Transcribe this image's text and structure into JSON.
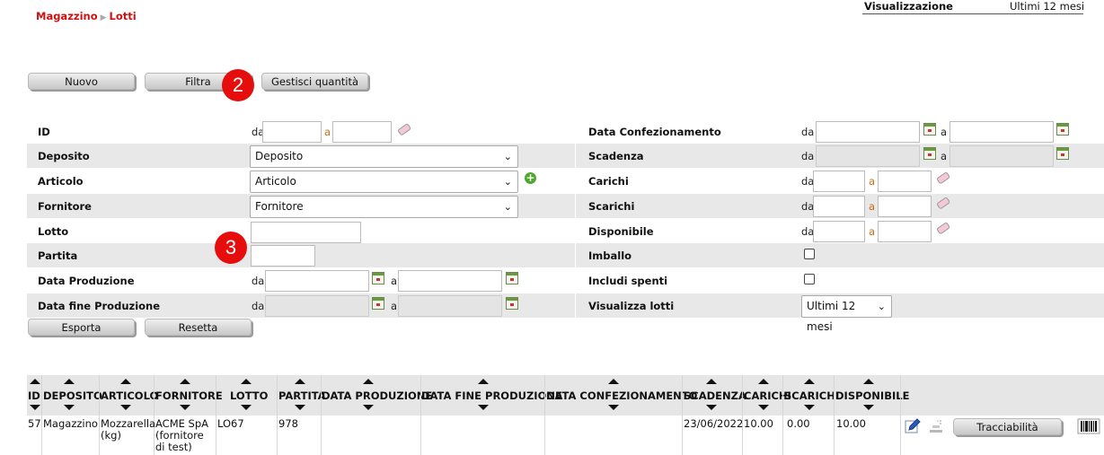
{
  "breadcrumb": {
    "first": "Magazzino",
    "second": "Lotti"
  },
  "view": {
    "label": "Visualizzazione",
    "value": "Ultimi 12 mesi"
  },
  "toolbar": {
    "new": "Nuovo",
    "filter": "Filtra",
    "manage_qty": "Gestisci quantità"
  },
  "badges": {
    "b2": "2",
    "b3": "3"
  },
  "filters": {
    "da": "da",
    "a": "a",
    "id": "ID",
    "deposito": "Deposito",
    "deposito_value": "Deposito",
    "articolo": "Articolo",
    "articolo_value": "Articolo",
    "fornitore": "Fornitore",
    "fornitore_value": "Fornitore",
    "lotto": "Lotto",
    "partita": "Partita",
    "data_produzione": "Data Produzione",
    "data_fine_produzione": "Data fine Produzione",
    "data_confezionamento": "Data Confezionamento",
    "scadenza": "Scadenza",
    "carichi": "Carichi",
    "scarichi": "Scarichi",
    "disponibile": "Disponibile",
    "imballo": "Imballo",
    "includi_spenti": "Includi spenti",
    "visualizza_lotti": "Visualizza lotti",
    "visualizza_lotti_value": "Ultimi 12 mesi"
  },
  "actions": {
    "export": "Esporta",
    "reset": "Resetta"
  },
  "table": {
    "headers": [
      "ID",
      "DEPOSITO",
      "ARTICOLO",
      "FORNITORE",
      "LOTTO",
      "PARTITA",
      "DATA PRODUZIONE",
      "DATA FINE PRODUZIONE",
      "DATA CONFEZIONAMENTO",
      "SCADENZA",
      "CARICHI",
      "SCARICHI",
      "DISPONIBILE"
    ],
    "rows": [
      {
        "id": "57",
        "deposito": "Magazzino",
        "articolo_1": "Mozzarella",
        "articolo_2": "(kg)",
        "fornitore_1": "ACME SpA",
        "fornitore_2": "(fornitore",
        "fornitore_3": "di test)",
        "lotto": "LO67",
        "partita": "978",
        "scadenza": "23/06/2022",
        "carichi": "10.00",
        "scarichi": "0.00",
        "disponibile": "10.00",
        "traceability": "Tracciabilità"
      }
    ]
  },
  "icons": {
    "edit": "pencil-edit-icon",
    "barcode": "barcode-icon",
    "move": "stack-icon",
    "calendar": "calendar-icon",
    "clear": "eraser-icon",
    "add": "add-icon"
  }
}
